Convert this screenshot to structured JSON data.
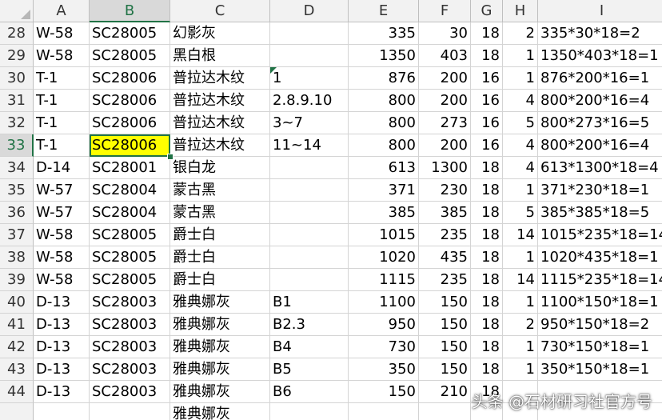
{
  "columns": [
    "A",
    "B",
    "C",
    "D",
    "E",
    "F",
    "G",
    "H",
    "I"
  ],
  "selected_column": "B",
  "selected_row": "33",
  "rows": [
    {
      "n": "28",
      "a": "W-58",
      "b": "SC28005",
      "c": "幻影灰",
      "d": "",
      "e": "335",
      "f": "30",
      "g": "18",
      "h": "2",
      "i": "335*30*18=2"
    },
    {
      "n": "29",
      "a": "W-58",
      "b": "SC28005",
      "c": "黑白根",
      "d": "",
      "e": "1350",
      "f": "403",
      "g": "18",
      "h": "1",
      "i": "1350*403*18=1"
    },
    {
      "n": "30",
      "a": "T-1",
      "b": "SC28006",
      "c": "普拉达木纹",
      "d": "1",
      "e": "876",
      "f": "200",
      "g": "16",
      "h": "1",
      "i": "876*200*16=1"
    },
    {
      "n": "31",
      "a": "T-1",
      "b": "SC28006",
      "c": "普拉达木纹",
      "d": "2.8.9.10",
      "e": "800",
      "f": "200",
      "g": "16",
      "h": "4",
      "i": "800*200*16=4"
    },
    {
      "n": "32",
      "a": "T-1",
      "b": "SC28006",
      "c": "普拉达木纹",
      "d": "3~7",
      "e": "800",
      "f": "273",
      "g": "16",
      "h": "5",
      "i": "800*273*16=5"
    },
    {
      "n": "33",
      "a": "T-1",
      "b": "SC28006",
      "c": "普拉达木纹",
      "d": "11~14",
      "e": "800",
      "f": "200",
      "g": "16",
      "h": "4",
      "i": "800*200*16=4"
    },
    {
      "n": "34",
      "a": "D-14",
      "b": "SC28001",
      "c": "银白龙",
      "d": "",
      "e": "613",
      "f": "1300",
      "g": "18",
      "h": "4",
      "i": "613*1300*18=4"
    },
    {
      "n": "35",
      "a": "W-57",
      "b": "SC28004",
      "c": "蒙古黑",
      "d": "",
      "e": "371",
      "f": "230",
      "g": "18",
      "h": "1",
      "i": "371*230*18=1"
    },
    {
      "n": "36",
      "a": "W-57",
      "b": "SC28004",
      "c": "蒙古黑",
      "d": "",
      "e": "385",
      "f": "385",
      "g": "18",
      "h": "5",
      "i": "385*385*18=5"
    },
    {
      "n": "37",
      "a": "W-58",
      "b": "SC28005",
      "c": "爵士白",
      "d": "",
      "e": "1015",
      "f": "235",
      "g": "18",
      "h": "14",
      "i": "1015*235*18=14"
    },
    {
      "n": "38",
      "a": "W-58",
      "b": "SC28005",
      "c": "爵士白",
      "d": "",
      "e": "1020",
      "f": "435",
      "g": "18",
      "h": "1",
      "i": "1020*435*18=1"
    },
    {
      "n": "39",
      "a": "W-58",
      "b": "SC28005",
      "c": "爵士白",
      "d": "",
      "e": "1115",
      "f": "235",
      "g": "18",
      "h": "14",
      "i": "1115*235*18=14"
    },
    {
      "n": "40",
      "a": "D-13",
      "b": "SC28003",
      "c": "雅典娜灰",
      "d": "B1",
      "e": "1100",
      "f": "150",
      "g": "18",
      "h": "1",
      "i": "1100*150*18=1"
    },
    {
      "n": "41",
      "a": "D-13",
      "b": "SC28003",
      "c": "雅典娜灰",
      "d": "B2.3",
      "e": "950",
      "f": "150",
      "g": "18",
      "h": "2",
      "i": "950*150*18=2"
    },
    {
      "n": "42",
      "a": "D-13",
      "b": "SC28003",
      "c": "雅典娜灰",
      "d": "B4",
      "e": "730",
      "f": "150",
      "g": "18",
      "h": "1",
      "i": "730*150*18=1"
    },
    {
      "n": "43",
      "a": "D-13",
      "b": "SC28003",
      "c": "雅典娜灰",
      "d": "B5",
      "e": "350",
      "f": "150",
      "g": "18",
      "h": "1",
      "i": "350*150*18=1"
    },
    {
      "n": "44",
      "a": "D-13",
      "b": "SC28003",
      "c": "雅典娜灰",
      "d": "B6",
      "e": "150",
      "f": "210",
      "g": "18",
      "h": "",
      "i": ""
    },
    {
      "n": "",
      "a": "",
      "b": "",
      "c": "雅典娜灰",
      "d": "",
      "e": "",
      "f": "",
      "g": "",
      "h": "",
      "i": ""
    }
  ],
  "watermark": "头条 @石材研习社官方号",
  "colors": {
    "active_fill": "#ffff00",
    "selection_accent": "#217346",
    "header_bg": "#f2f2f2"
  }
}
